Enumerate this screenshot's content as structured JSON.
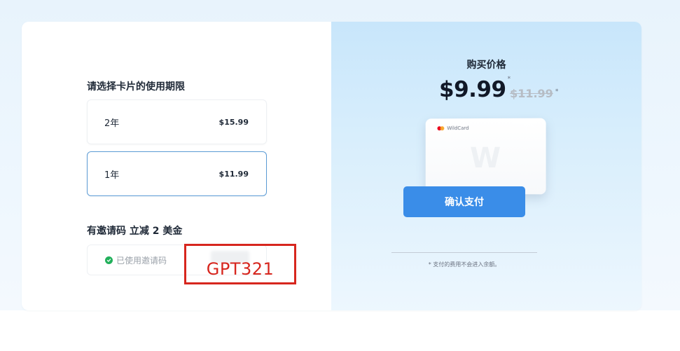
{
  "left": {
    "period_title": "请选择卡片的使用期限",
    "plans": [
      {
        "label": "2年",
        "price": "$15.99",
        "selected": false
      },
      {
        "label": "1年",
        "price": "$11.99",
        "selected": true
      }
    ],
    "invite_title": "有邀请码 立减 2 美金",
    "invite_status": "已使用邀请码",
    "annotation_code": "GPT321"
  },
  "right": {
    "buy_title": "购买价格",
    "price_now": "$9.99",
    "price_now_asterisk": "*",
    "price_old": "$11.99",
    "price_old_asterisk": "*",
    "card_brand": "WildCard",
    "card_letter": "W",
    "pay_button": "确认支付",
    "footnote": "* 支付的费用不会进入余额。"
  },
  "colors": {
    "accent": "#3a8de8",
    "selected_border": "#5b9bd5",
    "success": "#22b05b",
    "annotation": "#d7261e",
    "mastercard_red": "#eb001b",
    "mastercard_orange": "#f79e1b"
  }
}
